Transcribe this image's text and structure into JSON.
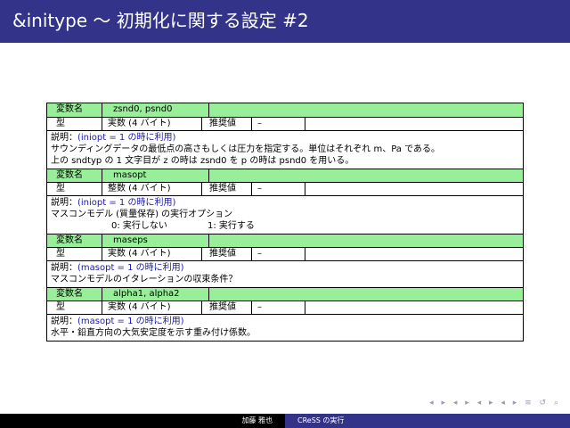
{
  "title": "&initype ～ 初期化に関する設定 #2",
  "labels": {
    "varname": "変数名",
    "type": "型",
    "recommended": "推奨値",
    "recommended_value": "–"
  },
  "vars": [
    {
      "name": "zsnd0, psnd0",
      "type": "実数 (4 バイト)",
      "desc_label": "説明：",
      "cond": "(iniopt = 1 の時に利用)",
      "lines": [
        "サウンディングデータの最低点の高さもしくは圧力を指定する。単位はそれぞれ m、Pa である。",
        "上の sndtyp の 1 文字目が z の時は zsnd0 を p の時は psnd0 を用いる。"
      ]
    },
    {
      "name": "masopt",
      "type": "整数 (4 バイト)",
      "desc_label": "説明：",
      "cond": "(iniopt = 1 の時に利用)",
      "lines": [
        "マスコンモデル (質量保存) の実行オプション"
      ],
      "options": [
        "0:  実行しない",
        "1:  実行する"
      ]
    },
    {
      "name": "maseps",
      "type": "実数 (4 バイト)",
      "desc_label": "説明：",
      "cond": "(masopt = 1 の時に利用)",
      "lines": [
        "マスコンモデルのイタレーションの収束条件？"
      ]
    },
    {
      "name": "alpha1, alpha2",
      "type": "実数 (4 バイト)",
      "desc_label": "説明：",
      "cond": "(masopt = 1 の時に利用)",
      "lines": [
        "水平・鉛直方向の大気安定度を示す重み付け係数。"
      ]
    }
  ],
  "nav": "◂ ▸ ◂ ▸ ◂ ▸ ◂ ▸   ≡   ↺ ⌕",
  "footer": {
    "author": "加藤 雅也",
    "talk": "CReSS の実行"
  },
  "colors": {
    "title_bg": "#33338a",
    "header_row_bg": "#99ee99",
    "condition_text": "#1a1aa6"
  }
}
